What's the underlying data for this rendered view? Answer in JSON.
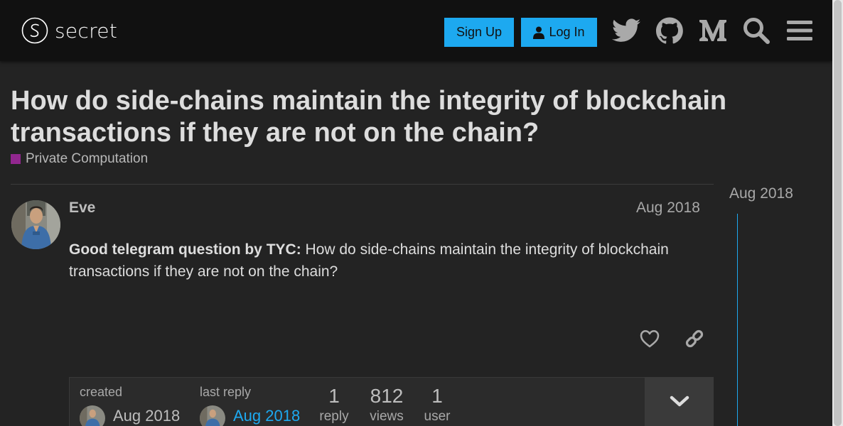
{
  "header": {
    "logo_text": "secret",
    "signup_label": "Sign Up",
    "login_label": "Log In"
  },
  "topic": {
    "title": "How do side-chains maintain the integrity of blockchain transactions if they are not on the chain?",
    "category": "Private Computation",
    "category_color": "#92278f"
  },
  "timeline": {
    "date": "Aug 2018"
  },
  "post": {
    "username": "Eve",
    "date": "Aug 2018",
    "body_bold": "Good telegram question by TYC:",
    "body_text": " How do side-chains maintain the integrity of blockchain transactions if they are not on the chain?"
  },
  "topic_map": {
    "created_label": "created",
    "created_date": "Aug 2018",
    "last_reply_label": "last reply",
    "last_reply_date": "Aug 2018",
    "replies_count": "1",
    "replies_label": "reply",
    "views_count": "812",
    "views_label": "views",
    "users_count": "1",
    "users_label": "user"
  },
  "colors": {
    "accent": "#1da9f0",
    "header_bg": "#111111",
    "page_bg": "#232323"
  }
}
